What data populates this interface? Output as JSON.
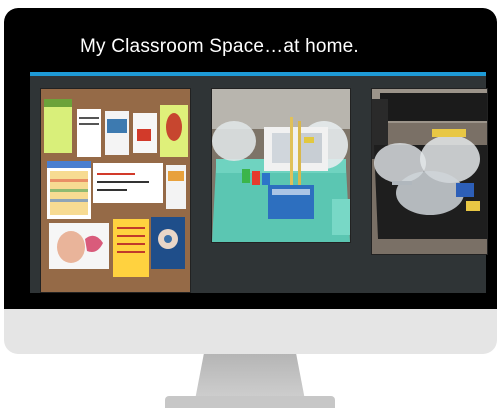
{
  "slide": {
    "title": "My Classroom Space…at home."
  },
  "photos": [
    {
      "subject": "classroom-wall-posters"
    },
    {
      "subject": "supply-bin-teal"
    },
    {
      "subject": "supply-bin-black"
    }
  ],
  "colors": {
    "accent_bar": "#1e9ad6",
    "slide_background": "#2f3436",
    "bezel": "#e5e5e5"
  }
}
